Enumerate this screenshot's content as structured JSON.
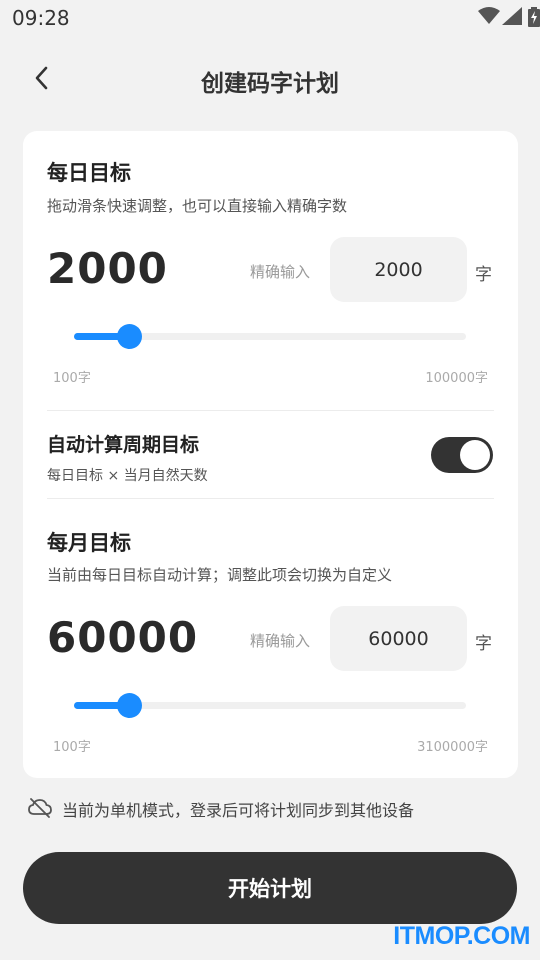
{
  "status_bar": {
    "time": "09:28",
    "icons": [
      "wifi-icon",
      "signal-icon",
      "battery-charging-icon"
    ]
  },
  "header": {
    "back_icon": "chevron-left-icon",
    "title": "创建码字计划"
  },
  "daily": {
    "title": "每日目标",
    "description": "拖动滑条快速调整，也可以直接输入精确字数",
    "value": "2000",
    "exact_label": "精确输入",
    "input_value": "2000",
    "unit": "字",
    "slider": {
      "min_label": "100字",
      "max_label": "100000字",
      "fill_fraction": 0.14
    }
  },
  "auto_calc": {
    "title": "自动计算周期目标",
    "description": "每日目标 × 当月自然天数",
    "enabled": true
  },
  "monthly": {
    "title": "每月目标",
    "description": "当前由每日目标自动计算；调整此项会切换为自定义",
    "value": "60000",
    "exact_label": "精确输入",
    "input_value": "60000",
    "unit": "字",
    "slider": {
      "min_label": "100字",
      "max_label": "3100000字",
      "fill_fraction": 0.14
    }
  },
  "offline_note": {
    "icon": "cloud-off-icon",
    "text": "当前为单机模式，登录后可将计划同步到其他设备"
  },
  "start_button": {
    "label": "开始计划"
  },
  "watermark": "ITMOP.COM",
  "colors": {
    "accent": "#1a8cff",
    "dark": "#333333",
    "background": "#f2f2f2"
  }
}
